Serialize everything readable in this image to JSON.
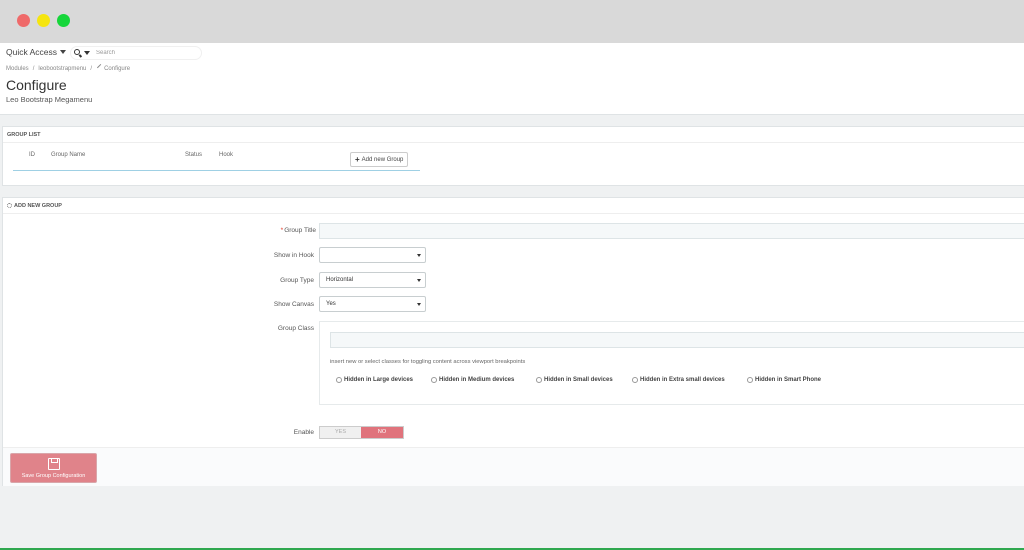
{
  "header": {
    "quick_access": "Quick Access",
    "search_placeholder": "Search",
    "breadcrumb": [
      "Modules",
      "/",
      "leobootstrapmenu",
      "/",
      "Configure"
    ],
    "title": "Configure",
    "subtitle": "Leo Bootstrap Megamenu"
  },
  "group_list": {
    "heading": "GROUP LIST",
    "columns": [
      "ID",
      "Group Name",
      "Status",
      "Hook"
    ],
    "add_button": "Add new Group"
  },
  "add_group": {
    "heading": "ADD NEW GROUP",
    "group_title_label": "Group Title",
    "show_in_hook_label": "Show in Hook",
    "show_in_hook_value": "",
    "group_type_label": "Group Type",
    "group_type_value": "Horizontal",
    "show_canvas_label": "Show Canvas",
    "show_canvas_value": "Yes",
    "group_class_label": "Group Class",
    "group_class_help": "insert new or select classes for toggling content across viewport breakpoints",
    "class_options": [
      "Hidden in Large devices",
      "Hidden in Medium devices",
      "Hidden in Small devices",
      "Hidden in Extra small devices",
      "Hidden in Smart Phone"
    ],
    "enable_label": "Enable",
    "enable_yes": "YES",
    "enable_no": "NO",
    "save_button": "Save Group Configuration"
  },
  "colors": {
    "accent": "#e0838a",
    "rule": "#9fd0e4"
  }
}
